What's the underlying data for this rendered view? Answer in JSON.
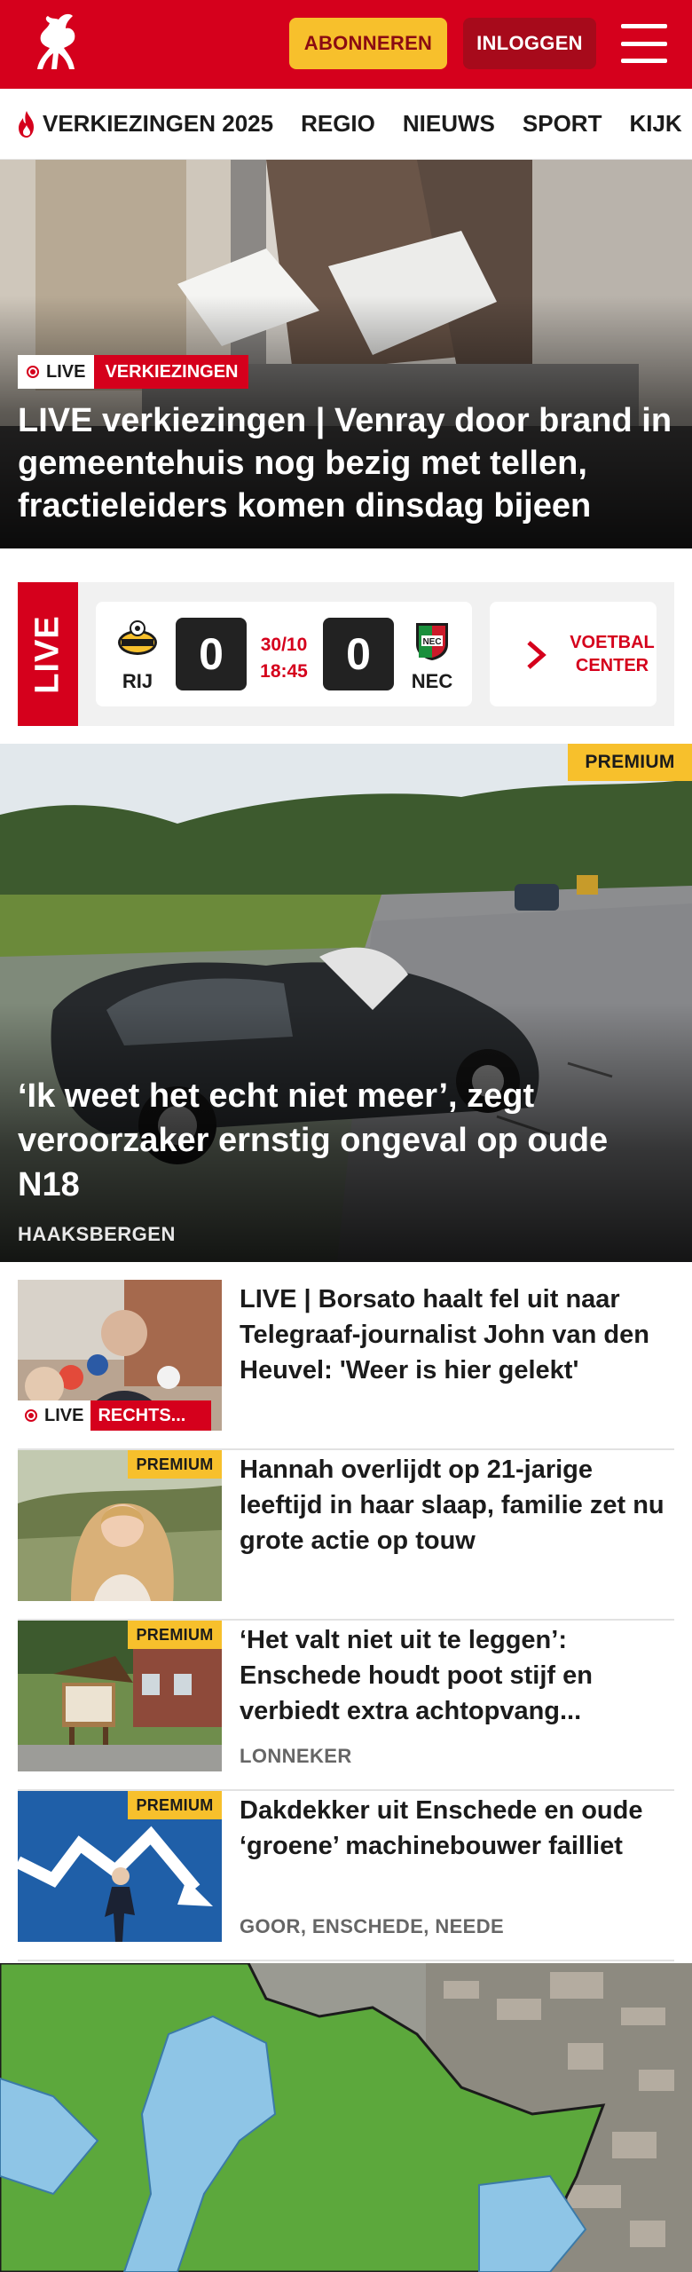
{
  "header": {
    "subscribe_label": "ABONNEREN",
    "login_label": "INLOGGEN"
  },
  "nav": {
    "items": [
      {
        "label": "VERKIEZINGEN 2025",
        "icon": "flame-icon"
      },
      {
        "label": "REGIO"
      },
      {
        "label": "NIEUWS"
      },
      {
        "label": "SPORT"
      },
      {
        "label": "KIJK"
      }
    ]
  },
  "hero": {
    "live_label": "LIVE",
    "category": "VERKIEZINGEN",
    "title": "LIVE verkiezingen | Venray door brand in gemeentehuis nog bezig met tellen, fractieleiders komen dinsdag bijeen"
  },
  "scoreboard": {
    "live_label": "LIVE",
    "home_team": "RIJ",
    "away_team": "NEC",
    "home_score": "0",
    "away_score": "0",
    "date": "30/10",
    "time": "18:45",
    "center_label": "VOETBAL CENTER",
    "home_crest_text": "Rijnsburgse Boys"
  },
  "featured": {
    "badge": "PREMIUM",
    "title": "‘Ik weet het echt niet meer’, zegt veroorzaker ernstig ongeval op oude N18",
    "location": "HAAKSBERGEN"
  },
  "articles": [
    {
      "title": "LIVE | Borsato haalt fel uit naar Telegraaf-journalist John van den Heuvel: 'Weer is hier gelekt'",
      "live_label": "LIVE",
      "category": "RECHTS...",
      "location": ""
    },
    {
      "badge": "PREMIUM",
      "title": "Hannah overlijdt op 21-jarige leeftijd in haar slaap, familie zet nu grote actie op touw",
      "location": ""
    },
    {
      "badge": "PREMIUM",
      "title": "‘Het valt niet uit te leggen’: Enschede houdt poot stijf en verbiedt extra achtopvang...",
      "location": "LONNEKER"
    },
    {
      "badge": "PREMIUM",
      "title": "Dakdekker uit Enschede en oude ‘groene’ machinebouwer failliet",
      "location": "GOOR, ENSCHEDE, NEEDE"
    }
  ],
  "colors": {
    "brand_red": "#d5001c",
    "premium_yellow": "#f7c02c",
    "login_dark_red": "#a70a1b"
  }
}
